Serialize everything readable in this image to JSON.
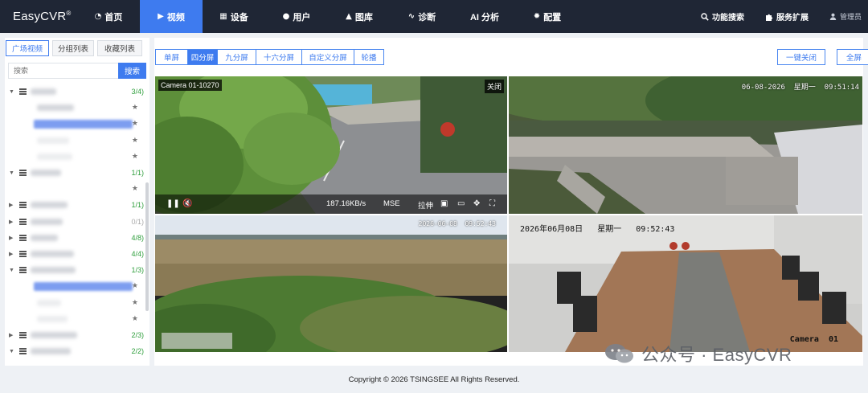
{
  "brand": {
    "name": "EasyCVR",
    "reg": "®"
  },
  "nav": [
    {
      "label": "首页",
      "icon": "dashboard-icon",
      "glyph": "◔"
    },
    {
      "label": "视频",
      "icon": "play-circle-icon",
      "glyph": "▶",
      "active": true
    },
    {
      "label": "设备",
      "icon": "device-icon",
      "glyph": "▦"
    },
    {
      "label": "用户",
      "icon": "user-icon",
      "glyph": "●"
    },
    {
      "label": "图库",
      "icon": "gallery-icon",
      "glyph": "▲"
    },
    {
      "label": "诊断",
      "icon": "pulse-icon",
      "glyph": "∿"
    },
    {
      "label": "AI 分析",
      "icon": "ai-icon",
      "glyph": ""
    },
    {
      "label": "配置",
      "icon": "gear-icon",
      "glyph": "✹"
    }
  ],
  "right_nav": {
    "search": "功能搜索",
    "extension": "服务扩展",
    "user": "管理员"
  },
  "sidebar": {
    "tabs": [
      "广场视频",
      "分组列表",
      "收藏列表"
    ],
    "search_placeholder": "搜索",
    "search_button": "搜索",
    "tree": [
      {
        "kind": "group",
        "arrow": "▼",
        "count": "3/4)",
        "blurw": 32
      },
      {
        "kind": "child",
        "blurw": 46,
        "star": true
      },
      {
        "kind": "selected",
        "star": true
      },
      {
        "kind": "child",
        "blurw": 40,
        "star": true,
        "faint": true
      },
      {
        "kind": "child",
        "blurw": 44,
        "star": true,
        "faint": true
      },
      {
        "kind": "group",
        "arrow": "▼",
        "count": "1/1)",
        "blurw": 38
      },
      {
        "kind": "child",
        "blurw": 0,
        "star": true
      },
      {
        "kind": "group",
        "arrow": "▶",
        "count": "1/1)",
        "blurw": 46
      },
      {
        "kind": "group",
        "arrow": "▶",
        "count": "0/1)",
        "blurw": 40,
        "off": true
      },
      {
        "kind": "group",
        "arrow": "▶",
        "count": "4/8)",
        "blurw": 34
      },
      {
        "kind": "group",
        "arrow": "▶",
        "count": "4/4)",
        "blurw": 54
      },
      {
        "kind": "group",
        "arrow": "▼",
        "count": "1/3)",
        "blurw": 56
      },
      {
        "kind": "selected",
        "star": true
      },
      {
        "kind": "child",
        "blurw": 30,
        "star": true,
        "faint": true
      },
      {
        "kind": "child",
        "blurw": 38,
        "star": true,
        "faint": true
      },
      {
        "kind": "group",
        "arrow": "▶",
        "count": "2/3)",
        "blurw": 58
      },
      {
        "kind": "group",
        "arrow": "▼",
        "count": "2/2)",
        "blurw": 50
      }
    ]
  },
  "toolbar": {
    "layouts": [
      "单屏",
      "四分屏",
      "九分屏",
      "十六分屏",
      "自定义分屏",
      "轮播"
    ],
    "active": "四分屏",
    "close_all": "一键关闭",
    "fullscreen": "全屏"
  },
  "player1": {
    "camera": "Camera 01-10270",
    "close": "关闭",
    "bitrate": "187.16KB/s",
    "mode": "MSE",
    "stretch": "拉伸"
  },
  "player2": {
    "timestamp": "06-08-2026  星期一  09:51:14"
  },
  "player3": {
    "timestamp": "2026-06-08  09:52:43"
  },
  "player4": {
    "timestamp": "2026年06月08日   星期一   09:52:43",
    "camera": "Camera  01"
  },
  "footer": "Copyright © 2026 TSINGSEE All Rights Reserved.",
  "watermark": "公众号 · EasyCVR",
  "colors": {
    "nav_bg": "#1f2635",
    "accent": "#3e7bef",
    "online": "#2e9e3c"
  }
}
